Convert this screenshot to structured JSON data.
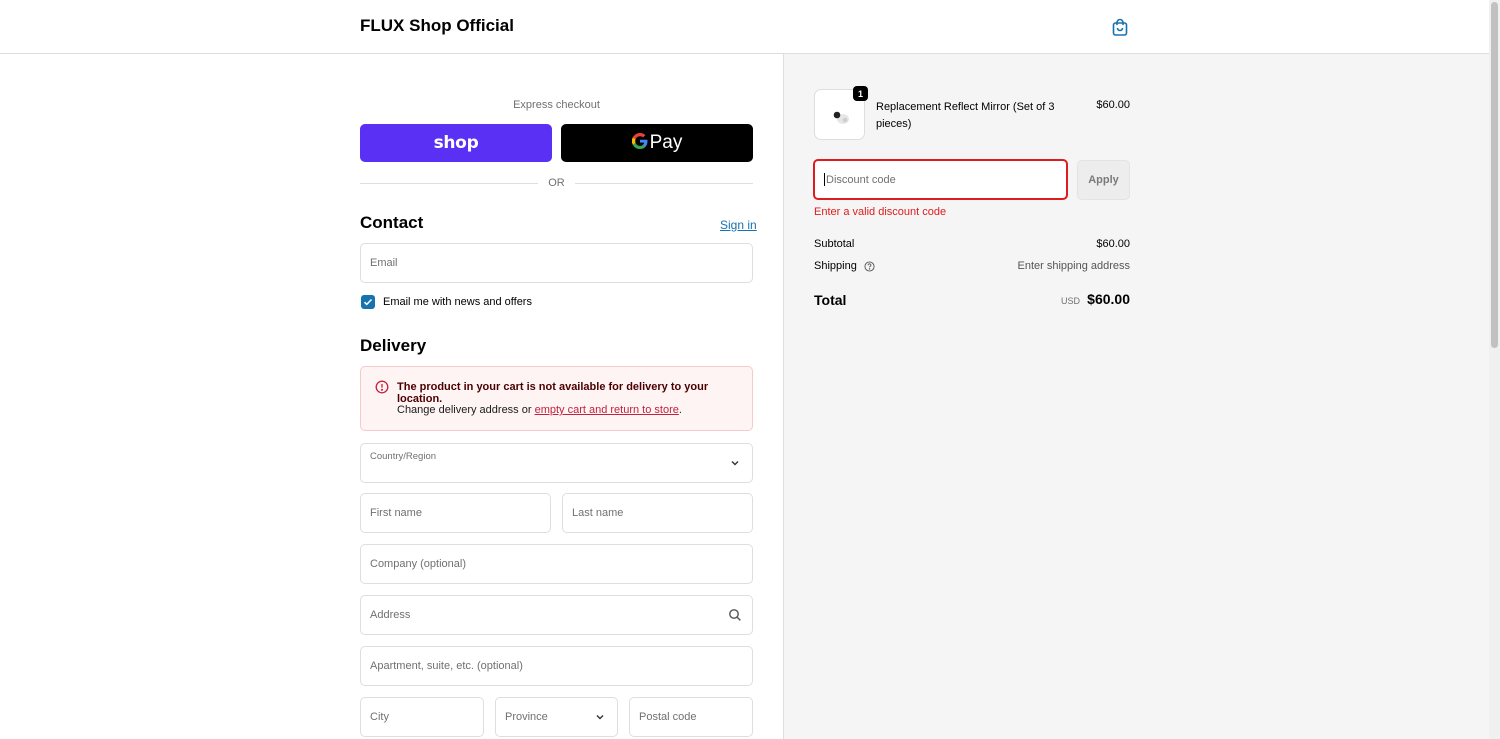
{
  "header": {
    "shop_title": "FLUX Shop Official",
    "cart_icon": "shopping-bag-icon"
  },
  "express": {
    "label": "Express checkout",
    "shop_pay_label": "shop",
    "gpay_g": "G",
    "gpay_label": "Pay",
    "or_text": "OR"
  },
  "contact": {
    "heading": "Contact",
    "sign_in_link": "Sign in",
    "email_placeholder": "Email",
    "newsletter_label": "Email me with news and offers",
    "newsletter_checked": true
  },
  "delivery": {
    "heading": "Delivery",
    "alert_title": "The product in your cart is not available for delivery to your location.",
    "alert_text_prefix": "Change delivery address or ",
    "alert_link": "empty cart and return to store",
    "alert_text_suffix": ".",
    "country_label": "Country/Region",
    "first_name_placeholder": "First name",
    "last_name_placeholder": "Last name",
    "company_placeholder": "Company (optional)",
    "address_placeholder": "Address",
    "apartment_placeholder": "Apartment, suite, etc. (optional)",
    "city_placeholder": "City",
    "province_placeholder": "Province",
    "postal_placeholder": "Postal code"
  },
  "order": {
    "item": {
      "name": "Replacement Reflect Mirror (Set of 3 pieces)",
      "price": "$60.00",
      "quantity": "1"
    },
    "discount_placeholder": "Discount code",
    "apply_label": "Apply",
    "discount_error": "Enter a valid discount code",
    "subtotal_label": "Subtotal",
    "subtotal_value": "$60.00",
    "shipping_label": "Shipping",
    "shipping_value": "Enter shipping address",
    "total_label": "Total",
    "currency": "USD",
    "total_value": "$60.00"
  },
  "colors": {
    "shop_pay": "#5a31f4",
    "link": "#1773b0",
    "error": "#dd1d1d",
    "panel_bg": "#f5f5f5"
  }
}
